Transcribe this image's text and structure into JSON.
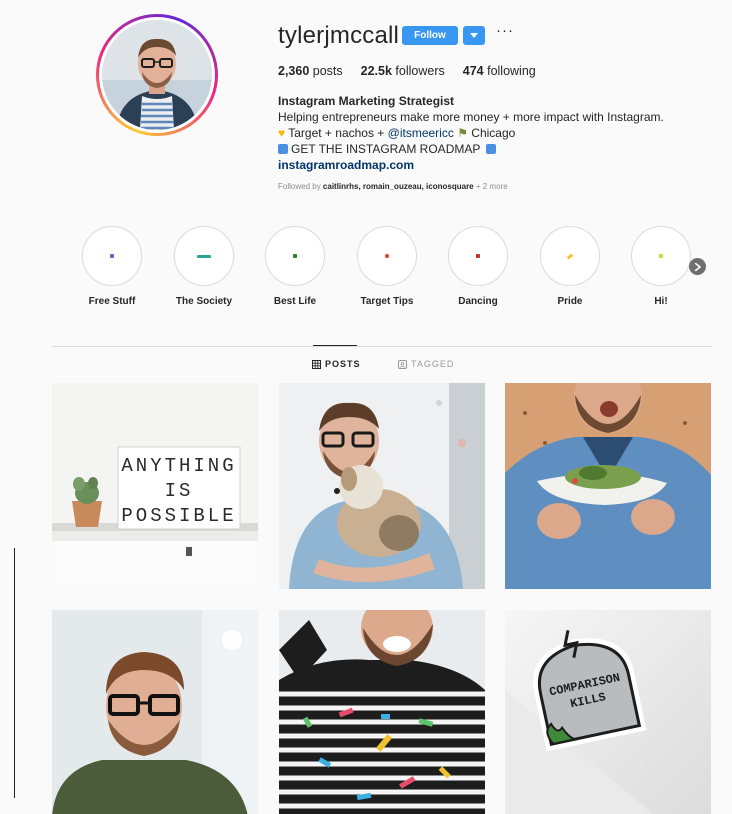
{
  "profile": {
    "username": "tylerjmccall",
    "follow_label": "Follow",
    "more_label": "···",
    "stats": {
      "posts_count": "2,360",
      "posts_label": "posts",
      "followers_count": "22.5k",
      "followers_label": "followers",
      "following_count": "474",
      "following_label": "following"
    },
    "bio": {
      "name": "Instagram Marketing Strategist",
      "line1": "Helping entrepreneurs make more money + more impact with Instagram.",
      "line2_pre": "Target + nachos + ",
      "line2_mention": "@itsmeericc",
      "line2_post": "Chicago",
      "line3": "GET THE INSTAGRAM ROADMAP",
      "website": "instagramroadmap.com"
    },
    "followed_by": {
      "prefix": "Followed by",
      "users": "caitlinrhs, romain_ouzeau, iconosquare",
      "more": "+ 2 more"
    }
  },
  "highlights": [
    {
      "label": "Free Stuff",
      "dot_color": "#5c6bc0"
    },
    {
      "label": "The Society",
      "dot_color": "#26a69a"
    },
    {
      "label": "Best Life",
      "dot_color": "#2e7d32"
    },
    {
      "label": "Target Tips",
      "dot_color": "#e53935"
    },
    {
      "label": "Dancing",
      "dot_color": "#c62828"
    },
    {
      "label": "Pride",
      "dot_color": "#fbc02d"
    },
    {
      "label": "Hi!",
      "dot_color": "#cddc39"
    }
  ],
  "tabs": {
    "posts": "POSTS",
    "tagged": "TAGGED"
  },
  "posts": [
    {
      "alt": "lightbox-sign-post",
      "sign_lines": [
        "ANYTHING",
        "IS",
        "POSSIBLE"
      ]
    },
    {
      "alt": "man-holding-dog-post"
    },
    {
      "alt": "man-holding-bowl-post"
    },
    {
      "alt": "man-portrait-post"
    },
    {
      "alt": "man-confetti-post"
    },
    {
      "alt": "comparison-kills-sticker-post",
      "sticker_lines": [
        "COMPARISON",
        "KILLS"
      ]
    }
  ],
  "colors": {
    "accent": "#3897f0",
    "link": "#003569",
    "muted": "#8e8e8e"
  }
}
